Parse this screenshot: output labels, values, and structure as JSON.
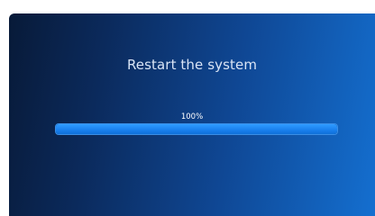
{
  "dialog": {
    "title": "Restart the system",
    "progress_label": "100%",
    "progress_fraction": 1.0
  },
  "colors": {
    "background_start": "#081a38",
    "background_end": "#146fd0",
    "progress_fill": "#1a82ef"
  }
}
